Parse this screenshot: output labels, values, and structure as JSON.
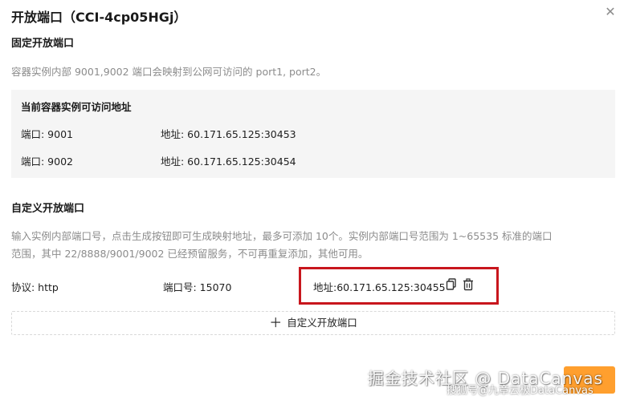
{
  "dialog": {
    "title": "开放端口（CCI-4cp05HGj）",
    "close_icon": "close-icon"
  },
  "fixed": {
    "heading": "固定开放端口",
    "note": "容器实例内部 9001,9002 端口会映射到公网可访问的 port1, port2。",
    "box_title": "当前容器实例可访问地址",
    "rows": [
      {
        "port": "端口: 9001",
        "address": "地址: 60.171.65.125:30453"
      },
      {
        "port": "端口: 9002",
        "address": "地址: 60.171.65.125:30454"
      }
    ]
  },
  "custom": {
    "heading": "自定义开放端口",
    "desc_line1": "输入实例内部端口号，点击生成按钮即可生成映射地址，最多可添加 10个。实例内部端口号范围为 1~65535 标准的端口",
    "desc_line2": "范围，其中 22/8888/9001/9002 已经预留服务，不可再重复添加，其他可用。",
    "entry": {
      "protocol": "协议: http",
      "port": "端口号: 15070",
      "address": "地址:60.171.65.125:30455"
    },
    "add_button": "自定义开放端口"
  },
  "footer": {
    "confirm_button": ""
  },
  "watermark": {
    "line1": "掘金技术社区 @ DataCanvas",
    "line2": "搜狐号@九章云极DataCanvas"
  },
  "colors": {
    "accent": "#ff9f2e",
    "highlight_border": "#c8161d",
    "muted_text": "#8c8c8c",
    "panel_bg": "#f5f5f5"
  }
}
